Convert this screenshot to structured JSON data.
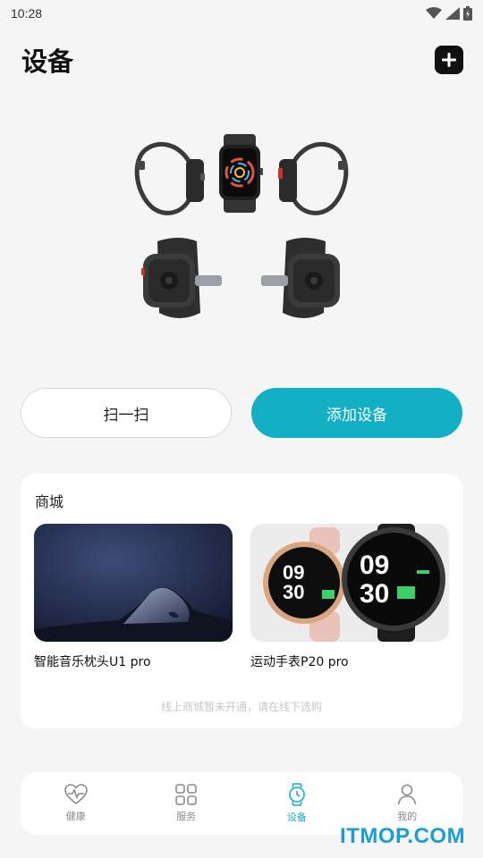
{
  "status_bar": {
    "time": "10:28"
  },
  "header": {
    "title": "设备"
  },
  "hero": {
    "image": "smartwatch-product-views"
  },
  "actions": {
    "scan_label": "扫一扫",
    "add_device_label": "添加设备"
  },
  "shop": {
    "title": "商城",
    "products": [
      {
        "name": "智能音乐枕头U1 pro",
        "image": "sleeping-person-photo"
      },
      {
        "name": "运动手表P20 pro",
        "image": "round-smartwatch-photo",
        "watch_hour": "09",
        "watch_minute": "30"
      }
    ],
    "note": "线上商城暂未开通，请在线下选购"
  },
  "tabbar": {
    "items": [
      {
        "label": "健康",
        "icon": "heart-pulse-icon"
      },
      {
        "label": "服务",
        "icon": "grid-icon"
      },
      {
        "label": "设备",
        "icon": "watch-icon",
        "active": true
      },
      {
        "label": "我的",
        "icon": "person-icon"
      }
    ]
  },
  "watermark": "ITMOP.COM",
  "colors": {
    "accent": "#12afc5",
    "background": "#f5f5f5",
    "card": "#ffffff"
  }
}
